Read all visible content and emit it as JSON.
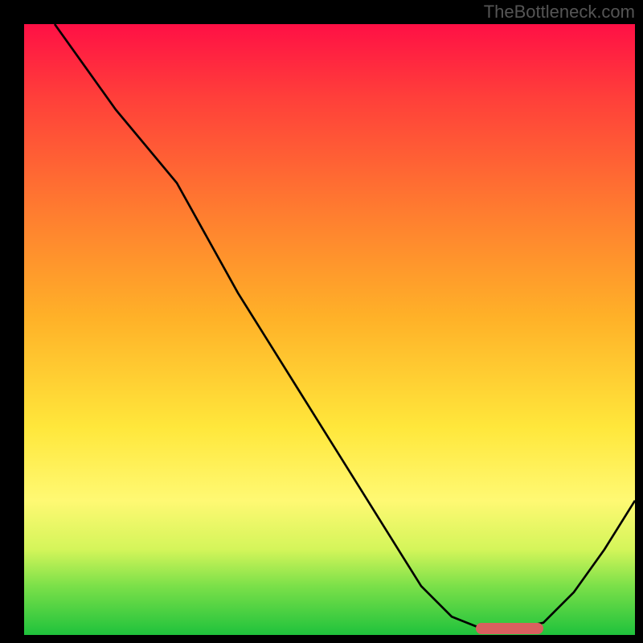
{
  "watermark": "TheBottleneck.com",
  "chart_data": {
    "type": "line",
    "title": "",
    "xlabel": "",
    "ylabel": "",
    "xlim": [
      0,
      100
    ],
    "ylim": [
      0,
      100
    ],
    "grid": false,
    "note": "x and y are in percent of the inner plot area; y=0 is the bottom. Values are estimated from the rendered curve since no axis ticks are visible.",
    "series": [
      {
        "name": "curve",
        "x": [
          5,
          10,
          15,
          20,
          25,
          30,
          35,
          40,
          45,
          50,
          55,
          60,
          65,
          70,
          75,
          80,
          85,
          90,
          95,
          100
        ],
        "y": [
          100,
          93,
          86,
          80,
          74,
          65,
          56,
          48,
          40,
          32,
          24,
          16,
          8,
          3,
          1,
          1,
          2,
          7,
          14,
          22
        ]
      }
    ],
    "optimum_band": {
      "x_start": 74,
      "x_end": 85,
      "y": 1,
      "color": "#d9605f"
    },
    "background_gradient": {
      "top": "#ff1045",
      "bottom": "#1fc23c"
    }
  }
}
